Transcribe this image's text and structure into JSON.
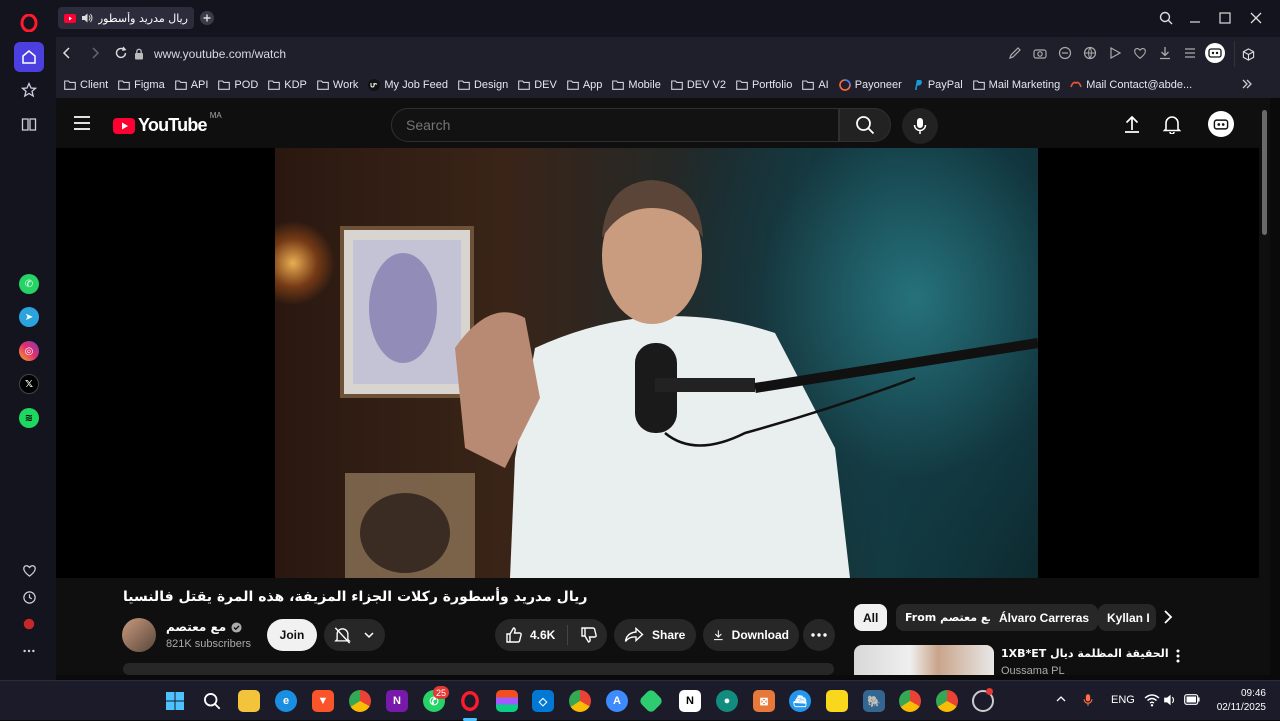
{
  "browser": {
    "tab": {
      "title": "ريال مدريد وأسطورة ركلات"
    },
    "address": {
      "url": "www.youtube.com/watch"
    },
    "bookmarks": [
      {
        "label": "Client",
        "icon": "folder-icon"
      },
      {
        "label": "Figma",
        "icon": "folder-icon"
      },
      {
        "label": "API",
        "icon": "folder-icon"
      },
      {
        "label": "POD",
        "icon": "folder-icon"
      },
      {
        "label": "KDP",
        "icon": "folder-icon"
      },
      {
        "label": "Work",
        "icon": "folder-icon"
      },
      {
        "label": "My Job Feed",
        "icon": "upwork-icon"
      },
      {
        "label": "Design",
        "icon": "folder-icon"
      },
      {
        "label": "DEV",
        "icon": "folder-icon"
      },
      {
        "label": "App",
        "icon": "folder-icon"
      },
      {
        "label": "Mobile",
        "icon": "folder-icon"
      },
      {
        "label": "DEV V2",
        "icon": "folder-icon"
      },
      {
        "label": "Portfolio",
        "icon": "folder-icon"
      },
      {
        "label": "AI",
        "icon": "folder-icon"
      },
      {
        "label": "Payoneer",
        "icon": "payoneer-icon"
      },
      {
        "label": "PayPal",
        "icon": "paypal-icon"
      },
      {
        "label": "Mail Marketing",
        "icon": "folder-icon"
      },
      {
        "label": "Mail Contact@abde...",
        "icon": "mail-icon"
      }
    ]
  },
  "youtube": {
    "logo_text": "YouTube",
    "region": "MA",
    "search_placeholder": "Search",
    "video": {
      "title": "ريال مدريد وأسطورة ركلات الجزاء المزيفة، هذه المرة يقتل فالنسيا",
      "channel_name": "مع معتصم",
      "subscribers": "821K subscribers",
      "join_label": "Join",
      "likes": "4.6K",
      "share_label": "Share",
      "download_label": "Download"
    },
    "chips": [
      "All",
      "From مع معتصم",
      "Álvaro Carreras",
      "Kyllan I"
    ],
    "recommended": {
      "title": "الحقيقة المظلمة ديال 1XB*ET",
      "channel": "Oussama PL"
    }
  },
  "taskbar": {
    "language": "ENG",
    "time": "09:46",
    "date": "02/11/2025",
    "whatsapp_badge": "25"
  },
  "colors": {
    "yt_red": "#ff0033",
    "opera_red": "#ff1b2d",
    "sidebar_active": "#4b3fe0"
  }
}
